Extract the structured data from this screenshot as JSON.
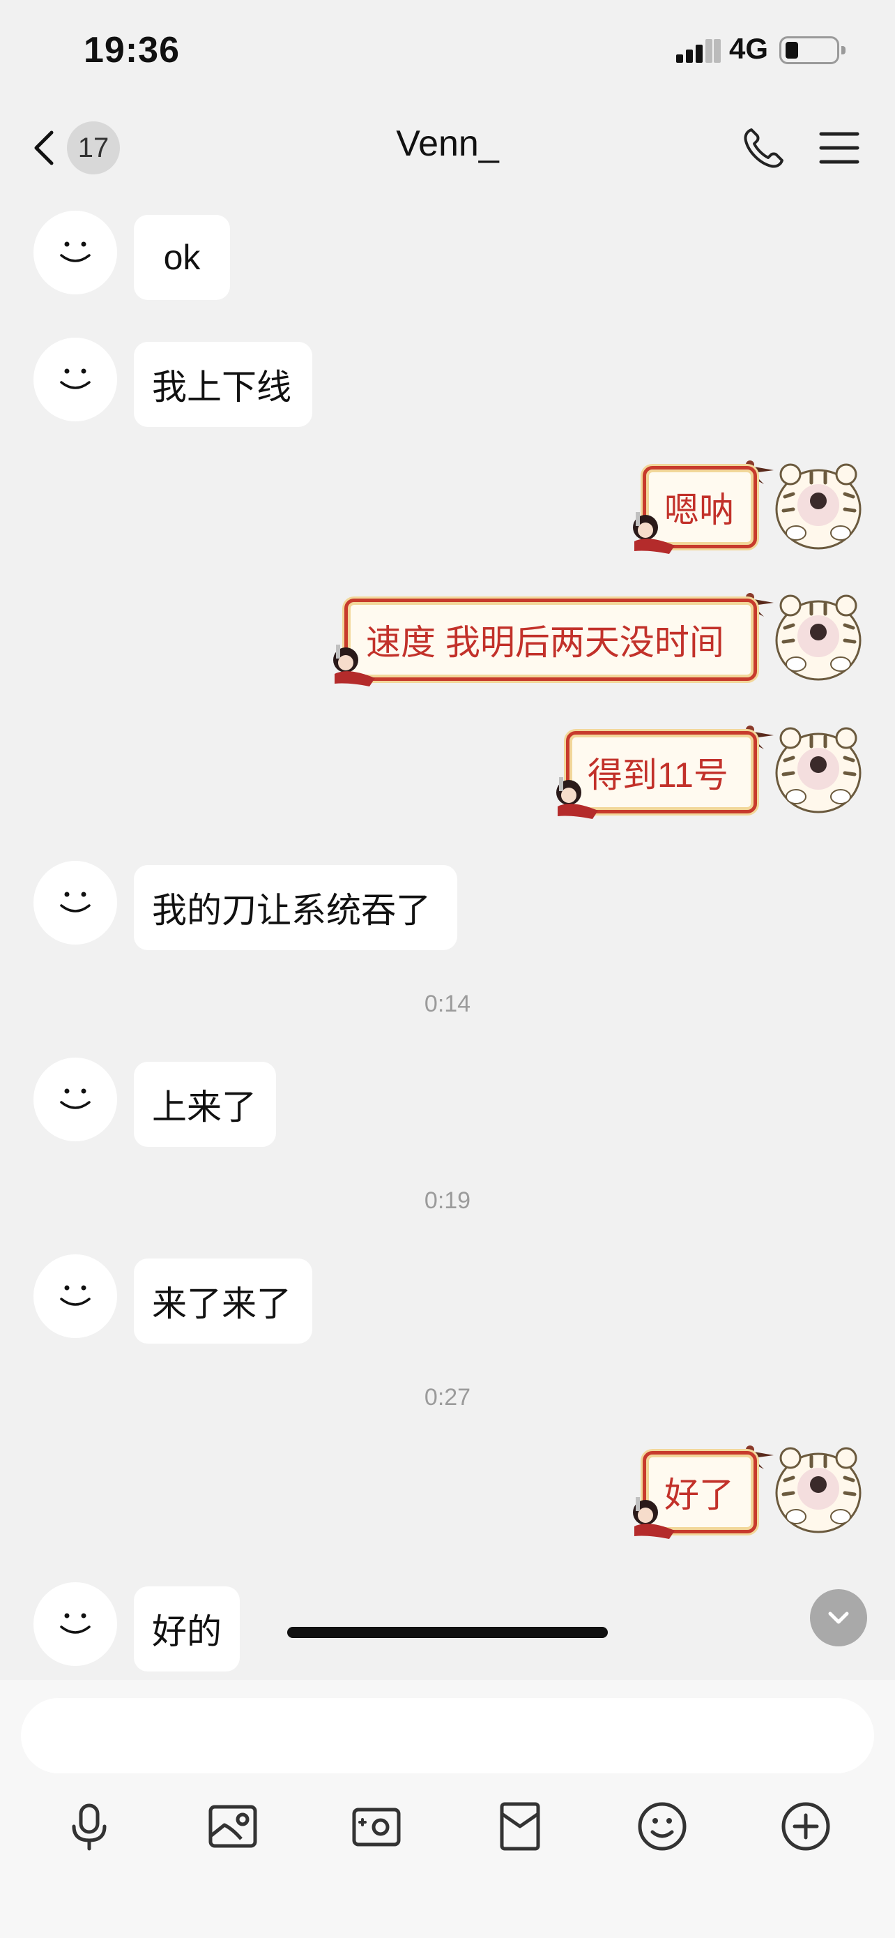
{
  "status_bar": {
    "time": "19:36",
    "network": "4G",
    "signal_icon": "signal-bars-icon",
    "battery_icon": "battery-low-icon"
  },
  "nav": {
    "unread_count": "17",
    "title": "Venn_",
    "back_icon": "chevron-left-icon",
    "call_icon": "phone-icon",
    "menu_icon": "hamburger-menu-icon"
  },
  "messages": [
    {
      "side": "in",
      "text": "ok"
    },
    {
      "side": "in",
      "text": "我上下线"
    },
    {
      "side": "out",
      "text": "嗯呐"
    },
    {
      "side": "out",
      "text": "速度 我明后两天没时间"
    },
    {
      "side": "out",
      "text": "得到11号"
    },
    {
      "side": "in",
      "text": "我的刀让系统吞了"
    },
    {
      "side": "time",
      "text": "0:14"
    },
    {
      "side": "in",
      "text": "上来了"
    },
    {
      "side": "time",
      "text": "0:19"
    },
    {
      "side": "in",
      "text": "来了来了"
    },
    {
      "side": "time",
      "text": "0:27"
    },
    {
      "side": "out",
      "text": "好了"
    },
    {
      "side": "in",
      "text": "好的"
    }
  ],
  "composer": {
    "placeholder": "",
    "value": ""
  },
  "toolbar": [
    "microphone-icon",
    "image-icon",
    "camera-icon",
    "red-packet-icon",
    "emoji-icon",
    "plus-icon"
  ],
  "colors": {
    "background": "#f1f1f1",
    "bubble_in": "#ffffff",
    "bubble_out_border": "#c73a2c",
    "bubble_out_text": "#c2312a"
  }
}
